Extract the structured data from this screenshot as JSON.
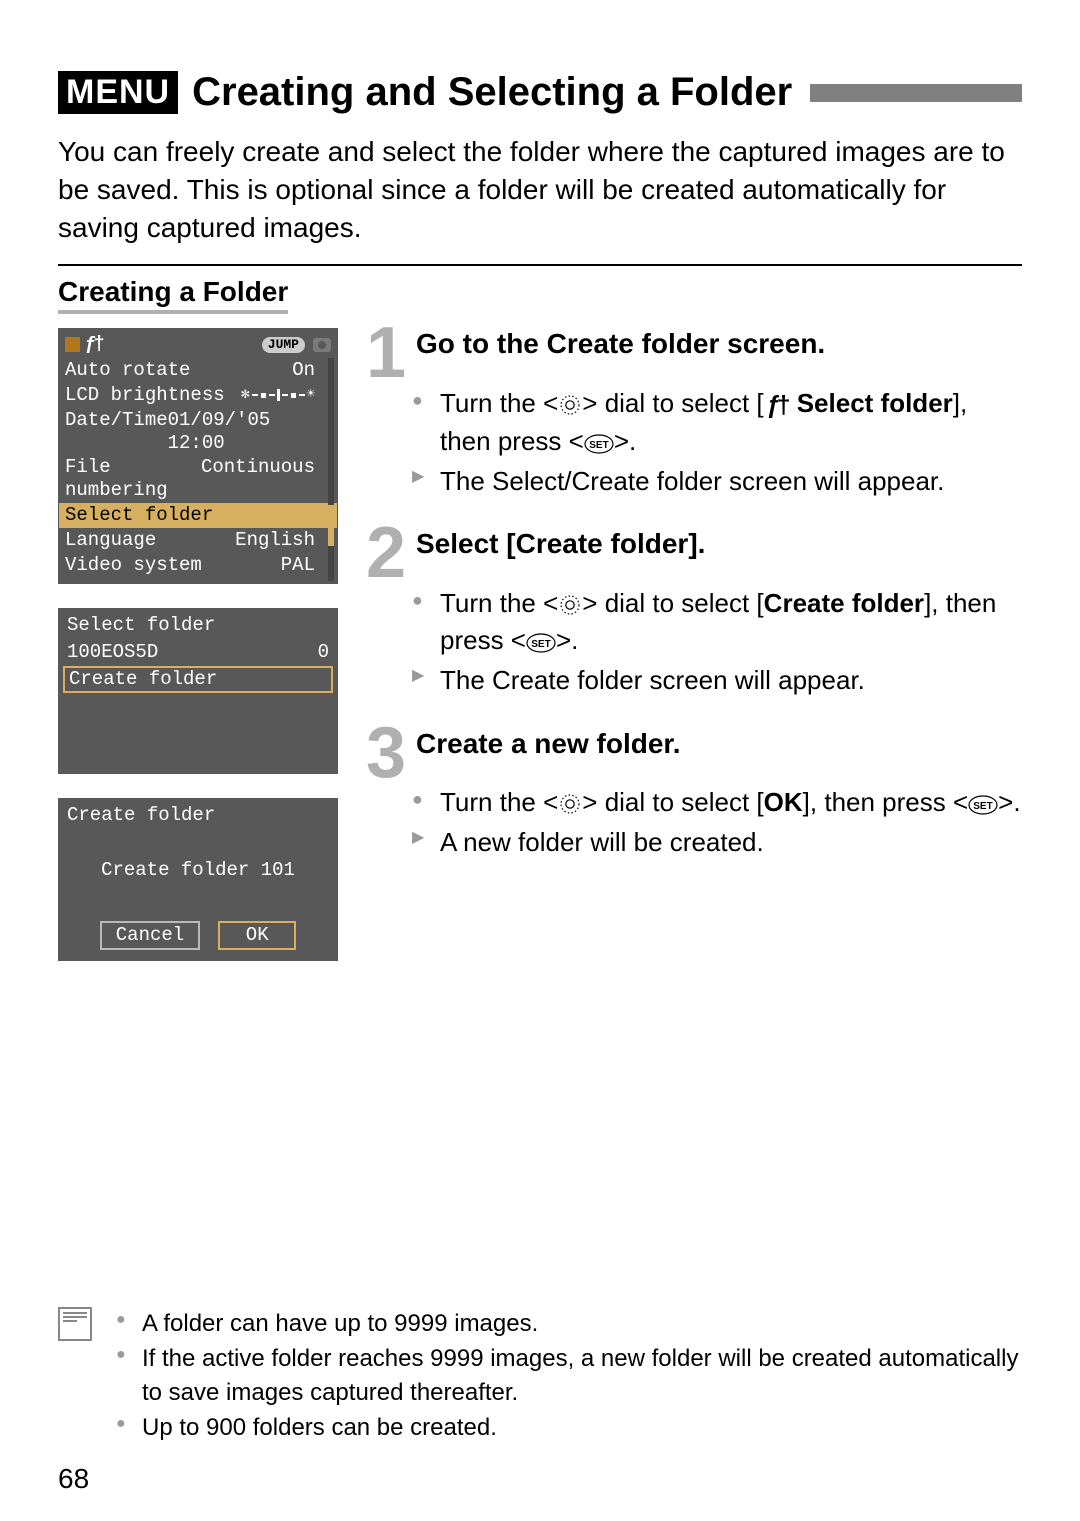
{
  "header": {
    "menu_badge": "MENU",
    "title": "Creating and Selecting a Folder"
  },
  "intro": "You can freely create and select the folder where the captured images are to be saved. This is optional since a folder will be created automatically for saving captured images.",
  "section_heading": "Creating a Folder",
  "screen1": {
    "jump": "JUMP",
    "rows": [
      {
        "label": "Auto rotate",
        "value": "On"
      },
      {
        "label": "LCD brightness",
        "value": ""
      },
      {
        "label": "Date/Time",
        "value": "01/09/'05 12:00"
      },
      {
        "label": "File numbering",
        "value": "Continuous"
      },
      {
        "label": "Select folder",
        "value": "",
        "selected": true
      },
      {
        "label": "Language",
        "value": "English"
      },
      {
        "label": "Video system",
        "value": "PAL"
      }
    ]
  },
  "screen2": {
    "title": "Select folder",
    "folder": {
      "name": "100EOS5D",
      "count": "0"
    },
    "create_label": "Create folder"
  },
  "screen3": {
    "title": "Create folder",
    "prompt": "Create folder 101",
    "cancel": "Cancel",
    "ok": "OK"
  },
  "steps": [
    {
      "num": "1",
      "title": "Go to the Create folder screen.",
      "items": [
        {
          "type": "dot",
          "pre": "Turn the <",
          "mid": "> dial to select [",
          "bold": "Select folder",
          "post": "], then press <",
          "after": ">."
        },
        {
          "type": "tri",
          "text": "The Select/Create folder screen will appear."
        }
      ]
    },
    {
      "num": "2",
      "title": "Select [Create folder].",
      "items": [
        {
          "type": "dot",
          "pre": "Turn the <",
          "mid": "> dial to select [",
          "bold": "Create folder",
          "post": "], then press <",
          "after": ">."
        },
        {
          "type": "tri",
          "text": "The Create folder screen will appear."
        }
      ]
    },
    {
      "num": "3",
      "title": "Create a new folder.",
      "items": [
        {
          "type": "dot",
          "pre": "Turn the <",
          "mid": "> dial to select [",
          "bold": "OK",
          "post": "], then press <",
          "after": ">."
        },
        {
          "type": "tri",
          "text": "A new folder will be created."
        }
      ]
    }
  ],
  "notes": [
    "A folder can have up to 9999 images.",
    "If the active folder reaches 9999 images, a new folder will be created automatically to save images captured thereafter.",
    "Up to 900 folders can be created."
  ],
  "page_number": "68"
}
